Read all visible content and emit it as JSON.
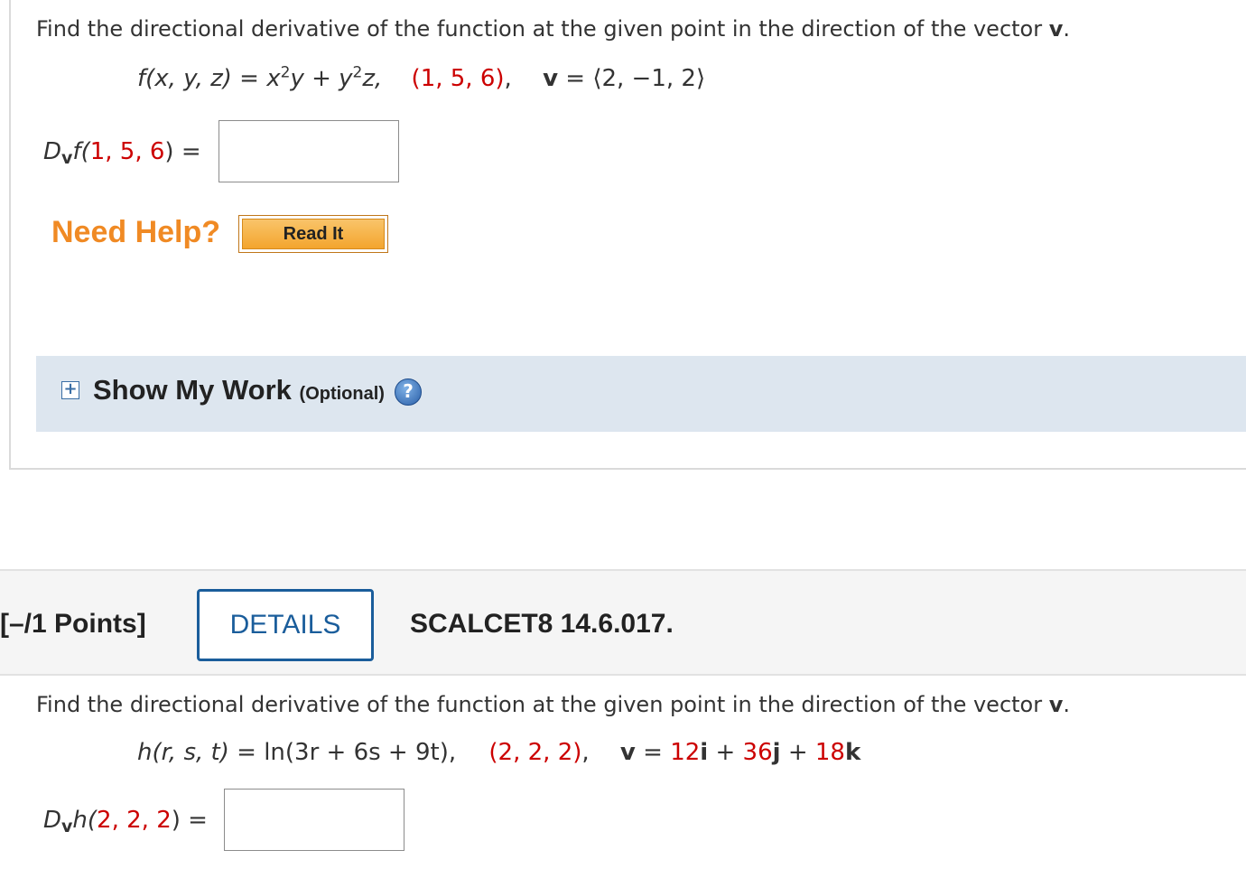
{
  "question1": {
    "prompt_text": "Find the directional derivative of the function at the given point in the direction of the vector",
    "prompt_vec": "v",
    "prompt_end": ".",
    "function_lhs": "f(x, y, z) = x",
    "function_exp1": "2",
    "function_mid": "y + y",
    "function_exp2": "2",
    "function_end": "z,",
    "point": "(1, 5, 6)",
    "point_comma": ",",
    "vector_name": "v",
    "vector_eq": " = ⟨2, −1, 2⟩",
    "answer_D": "D",
    "answer_sub": "v",
    "answer_f": "f(",
    "answer_point": "1, 5, 6",
    "answer_close": ") =",
    "answer_value": "",
    "need_help_label": "Need Help?",
    "read_it_label": "Read It",
    "show_work_title": "Show My Work",
    "show_work_optional": "(Optional)",
    "show_work_toggle": "+",
    "help_icon": "?"
  },
  "question2": {
    "points_label": "[–/1 Points]",
    "details_label": "DETAILS",
    "code": "SCALCET8 14.6.017.",
    "prompt_text": "Find the directional derivative of the function at the given point in the direction of the vector",
    "prompt_vec": "v",
    "prompt_end": ".",
    "function_lhs": "h(r, s, t)",
    "function_rhs": " = ln(3r + 6s + 9t),",
    "point": "(2, 2, 2)",
    "point_comma": ",",
    "vector_name": "v",
    "vector_eq": " = ",
    "vec_c1": "12",
    "vec_i": "i",
    "plus1": " + ",
    "vec_c2": "36",
    "vec_j": "j",
    "plus2": " + ",
    "vec_c3": "18",
    "vec_k": "k",
    "answer_D": "D",
    "answer_sub": "v",
    "answer_h": "h(",
    "answer_point": "2, 2, 2",
    "answer_close": ") =",
    "answer_value": ""
  },
  "colors": {
    "accent_red": "#cc0000",
    "need_help_orange": "#f08a24",
    "details_blue": "#1a5d9b",
    "show_work_bg": "#dde6ef"
  }
}
